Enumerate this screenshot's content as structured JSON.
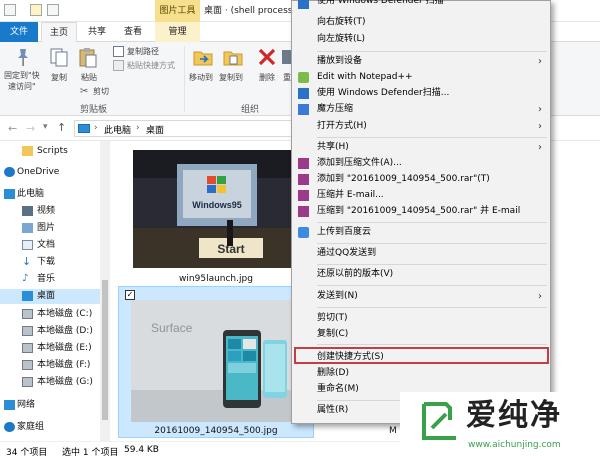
{
  "titlebar": {
    "picture_tools": "图片工具",
    "window_title": "桌面 · (shell process"
  },
  "tabs": {
    "file": "文件",
    "home": "主页",
    "share": "共享",
    "view": "查看",
    "manage": "管理"
  },
  "ribbon": {
    "pin": "固定到\"快\n速访问\"",
    "copy": "复制",
    "paste": "粘贴",
    "cut": "剪切",
    "copy_path": "复制路径",
    "paste_shortcut": "粘贴快捷方式",
    "clipboard_group": "剪贴板",
    "move_to": "移动到",
    "copy_to": "复制到",
    "delete": "删除",
    "rename": "重",
    "organize_group": "组织"
  },
  "address": {
    "this_pc": "此电脑",
    "desktop": "桌面",
    "sep": "›"
  },
  "nav": {
    "scripts": "Scripts",
    "onedrive": "OneDrive",
    "this_pc": "此电脑",
    "videos": "视频",
    "pictures": "图片",
    "documents": "文档",
    "downloads": "下载",
    "music": "音乐",
    "desktop": "桌面",
    "disk_c": "本地磁盘 (C:)",
    "disk_d": "本地磁盘 (D:)",
    "disk_e": "本地磁盘 (E:)",
    "disk_f": "本地磁盘 (F:)",
    "disk_g": "本地磁盘 (G:)",
    "network": "网络",
    "homegroup": "家庭组"
  },
  "files": {
    "file1": "win95launch.jpg",
    "file2": "20161009_140954_500.jpg",
    "thumb1_text": "Windows95",
    "thumb1_banner": "Start",
    "thumb2_text": "Surface",
    "partial_label": "M"
  },
  "status": {
    "items": "34 个项目",
    "selected": "选中 1 个项目",
    "size": "59.4 KB"
  },
  "context_menu": {
    "defender_top": "使用 Windows Defender 扫描",
    "rotate_right": "向右旋转(T)",
    "rotate_left": "向左旋转(L)",
    "cast": "播放到设备",
    "notepad": "Edit with Notepad++",
    "defender": "使用 Windows Defender扫描...",
    "rubik": "魔方压缩",
    "open_with": "打开方式(H)",
    "share": "共享(H)",
    "add_archive": "添加到压缩文件(A)...",
    "add_rar": "添加到 \"20161009_140954_500.rar\"(T)",
    "compress_email": "压缩并 E-mail...",
    "compress_rar_email": "压缩到 \"20161009_140954_500.rar\" 并 E-mail",
    "baidu": "上传到百度云",
    "qq": "通过QQ发送到",
    "restore": "还原以前的版本(V)",
    "send_to": "发送到(N)",
    "cut": "剪切(T)",
    "copy": "复制(C)",
    "create_shortcut": "创建快捷方式(S)",
    "delete": "删除(D)",
    "rename": "重命名(M)",
    "properties": "属性(R)"
  },
  "watermark": {
    "brand": "爱纯净",
    "url": "www.aichunjing.com"
  },
  "colors": {
    "file_tab": "#1979ca",
    "picture_tools": "#f6e08e",
    "selection": "#cce8ff",
    "highlight_border": "#c43c45",
    "watermark_green": "#3aa04c"
  }
}
